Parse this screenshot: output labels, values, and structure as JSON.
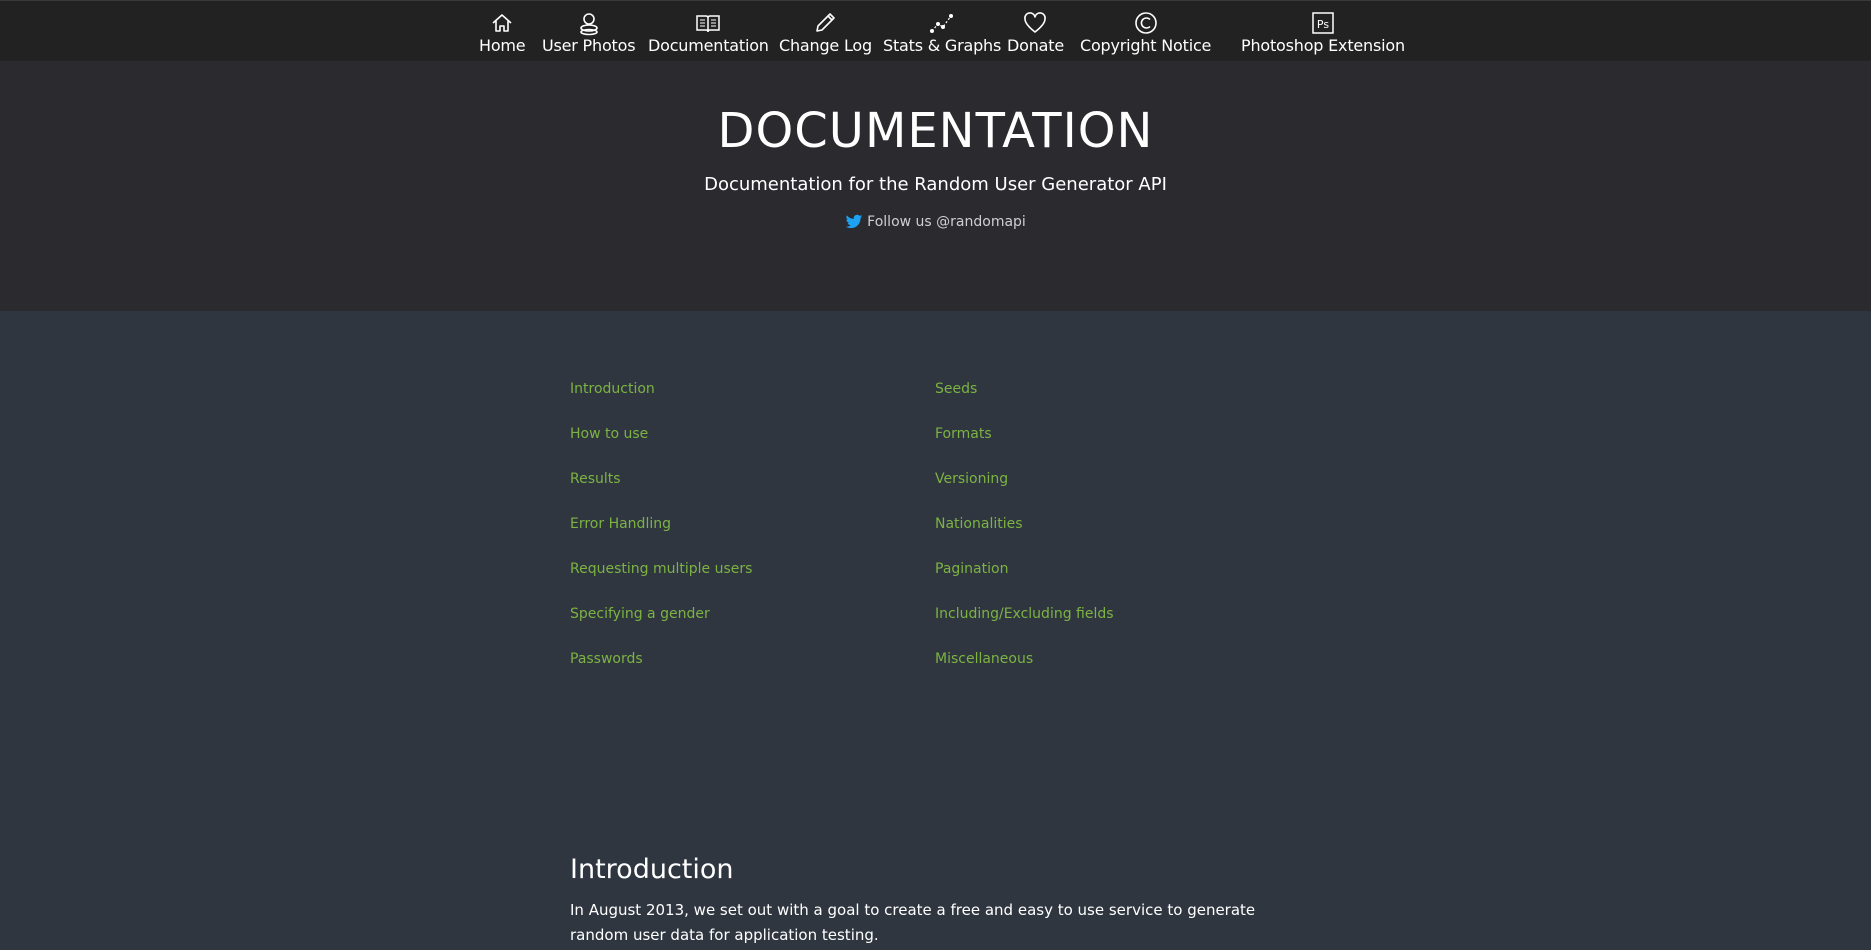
{
  "nav": {
    "items": [
      {
        "label": "Home",
        "icon": "home-icon"
      },
      {
        "label": "User Photos",
        "icon": "user-photos-icon"
      },
      {
        "label": "Documentation",
        "icon": "book-icon"
      },
      {
        "label": "Change Log",
        "icon": "pencil-icon"
      },
      {
        "label": "Stats & Graphs",
        "icon": "graph-icon"
      },
      {
        "label": "Donate",
        "icon": "heart-icon"
      },
      {
        "label": "Copyright Notice",
        "icon": "copyright-icon"
      },
      {
        "label": "Photoshop Extension",
        "icon": "photoshop-icon"
      }
    ]
  },
  "hero": {
    "title": "DOCUMENTATION",
    "subtitle": "Documentation for the Random User Generator API",
    "follow_text": "Follow us @randomapi"
  },
  "toc": {
    "col1": [
      "Introduction",
      "How to use",
      "Results",
      "Error Handling",
      "Requesting multiple users",
      "Specifying a gender",
      "Passwords"
    ],
    "col2": [
      "Seeds",
      "Formats",
      "Versioning",
      "Nationalities",
      "Pagination",
      "Including/Excluding fields",
      "Miscellaneous"
    ]
  },
  "intro": {
    "heading": "Introduction",
    "body": "In August 2013, we set out with a goal to create a free and easy to use service to generate random user data for application testing."
  },
  "colors": {
    "nav_bg": "#222222",
    "hero_bg": "#2b2b2f",
    "page_bg": "#2f3640",
    "link": "#7cb342",
    "twitter": "#1da1f2"
  }
}
